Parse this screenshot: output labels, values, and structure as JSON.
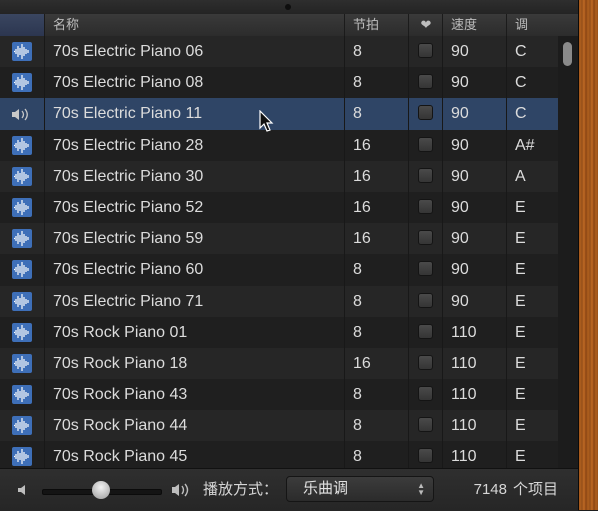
{
  "header": {
    "name": "名称",
    "beats": "节拍",
    "favorite_icon": "heart-icon",
    "tempo": "速度",
    "key": "调"
  },
  "rows": [
    {
      "name": "70s Electric Piano 06",
      "beats": "8",
      "tempo": "90",
      "key": "C",
      "icon": "waveform-icon",
      "selected": false
    },
    {
      "name": "70s Electric Piano 08",
      "beats": "8",
      "tempo": "90",
      "key": "C",
      "icon": "waveform-icon",
      "selected": false
    },
    {
      "name": "70s Electric Piano 11",
      "beats": "8",
      "tempo": "90",
      "key": "C",
      "icon": "speaker-icon",
      "selected": true
    },
    {
      "name": "70s Electric Piano 28",
      "beats": "16",
      "tempo": "90",
      "key": "A#",
      "icon": "waveform-icon",
      "selected": false
    },
    {
      "name": "70s Electric Piano 30",
      "beats": "16",
      "tempo": "90",
      "key": "A",
      "icon": "waveform-icon",
      "selected": false
    },
    {
      "name": "70s Electric Piano 52",
      "beats": "16",
      "tempo": "90",
      "key": "E",
      "icon": "waveform-icon",
      "selected": false
    },
    {
      "name": "70s Electric Piano 59",
      "beats": "16",
      "tempo": "90",
      "key": "E",
      "icon": "waveform-icon",
      "selected": false
    },
    {
      "name": "70s Electric Piano 60",
      "beats": "8",
      "tempo": "90",
      "key": "E",
      "icon": "waveform-icon",
      "selected": false
    },
    {
      "name": "70s Electric Piano 71",
      "beats": "8",
      "tempo": "90",
      "key": "E",
      "icon": "waveform-icon",
      "selected": false
    },
    {
      "name": "70s Rock Piano 01",
      "beats": "8",
      "tempo": "110",
      "key": "E",
      "icon": "waveform-icon",
      "selected": false
    },
    {
      "name": "70s Rock Piano 18",
      "beats": "16",
      "tempo": "110",
      "key": "E",
      "icon": "waveform-icon",
      "selected": false
    },
    {
      "name": "70s Rock Piano 43",
      "beats": "8",
      "tempo": "110",
      "key": "E",
      "icon": "waveform-icon",
      "selected": false
    },
    {
      "name": "70s Rock Piano 44",
      "beats": "8",
      "tempo": "110",
      "key": "E",
      "icon": "waveform-icon",
      "selected": false
    },
    {
      "name": "70s Rock Piano 45",
      "beats": "8",
      "tempo": "110",
      "key": "E",
      "icon": "waveform-icon",
      "selected": false
    }
  ],
  "footer": {
    "volume_low_icon": "speaker-low-icon",
    "volume_high_icon": "speaker-high-icon",
    "volume_level": 0.5,
    "play_label": "播放方式：",
    "play_mode": "乐曲调",
    "count": "7148",
    "count_suffix": "个项目"
  },
  "colors": {
    "accent": "#3e6fb8",
    "selection": "#2f4566",
    "wood": "#b0601e"
  }
}
